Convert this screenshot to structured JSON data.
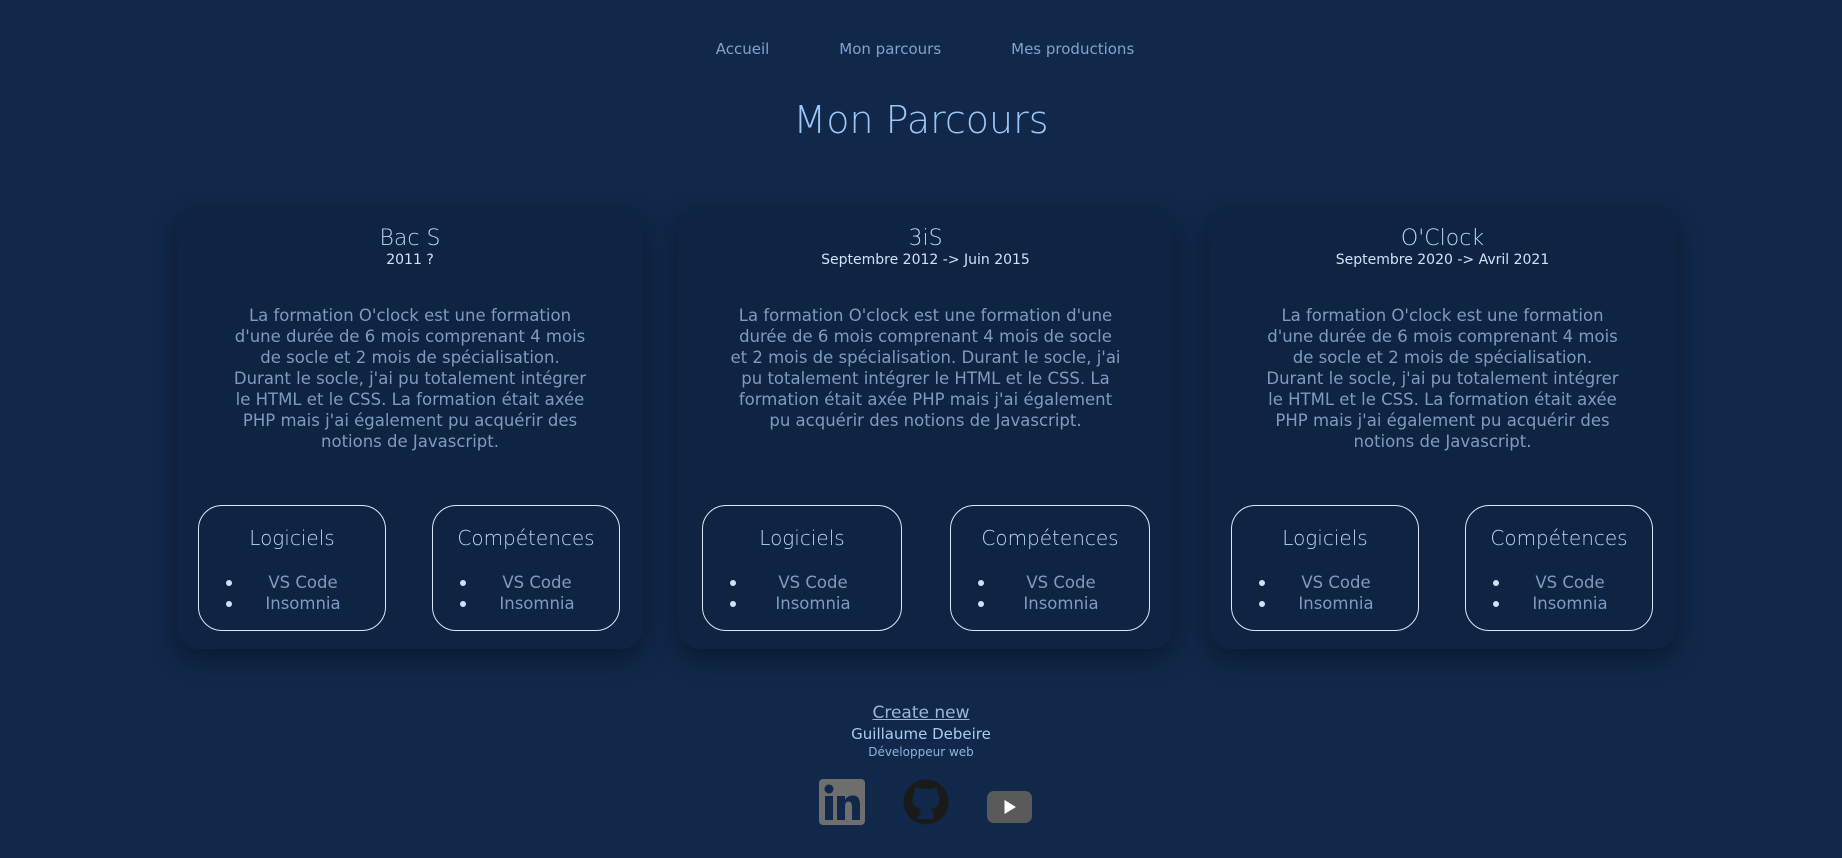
{
  "nav": {
    "items": [
      "Accueil",
      "Mon parcours",
      "Mes productions"
    ]
  },
  "page": {
    "title": "Mon Parcours"
  },
  "cards": [
    {
      "title": "Bac S",
      "dates": "2011 ?",
      "description": "La formation O'clock est une formation d'une durée de 6 mois comprenant 4 mois de socle et 2 mois de spécialisation. Durant le socle, j'ai pu totalement intégrer le HTML et le CSS. La formation était axée PHP mais j'ai également pu acquérir des notions de Javascript.",
      "software": {
        "title": "Logiciels",
        "items": [
          "VS Code",
          "Insomnia"
        ]
      },
      "skills": {
        "title": "Compétences",
        "items": [
          "VS Code",
          "Insomnia"
        ]
      }
    },
    {
      "title": "3iS",
      "dates": "Septembre 2012 -> Juin 2015",
      "description": "La formation O'clock est une formation d'une durée de 6 mois comprenant 4 mois de socle et 2 mois de spécialisation. Durant le socle, j'ai pu totalement intégrer le HTML et le CSS. La formation était axée PHP mais j'ai également pu acquérir des notions de Javascript.",
      "software": {
        "title": "Logiciels",
        "items": [
          "VS Code",
          "Insomnia"
        ]
      },
      "skills": {
        "title": "Compétences",
        "items": [
          "VS Code",
          "Insomnia"
        ]
      }
    },
    {
      "title": "O'Clock",
      "dates": "Septembre 2020 -> Avril 2021",
      "description": "La formation O'clock est une formation d'une durée de 6 mois comprenant 4 mois de socle et 2 mois de spécialisation. Durant le socle, j'ai pu totalement intégrer le HTML et le CSS. La formation était axée PHP mais j'ai également pu acquérir des notions de Javascript.",
      "software": {
        "title": "Logiciels",
        "items": [
          "VS Code",
          "Insomnia"
        ]
      },
      "skills": {
        "title": "Compétences",
        "items": [
          "VS Code",
          "Insomnia"
        ]
      }
    }
  ],
  "footer": {
    "create_link": "Create new",
    "name": "Guillaume Debeire",
    "role": "Développeur web",
    "social": [
      {
        "icon": "linkedin-icon"
      },
      {
        "icon": "github-icon"
      },
      {
        "icon": "youtube-icon"
      }
    ]
  },
  "colors": {
    "background": "#11284a",
    "card": "#0f2443",
    "accent": "#9cc6f5",
    "text_muted": "#7e9bbf"
  }
}
